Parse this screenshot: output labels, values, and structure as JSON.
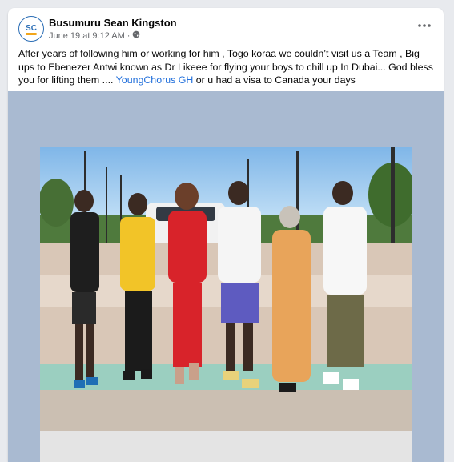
{
  "post": {
    "author": "Busumuru Sean Kingston",
    "avatar_initials": "SC",
    "date": "June 19 at 9:12 AM",
    "separator": "·",
    "audience_icon": "globe-icon",
    "more_icon": "more-options-icon",
    "text_part1": "After years of following him or working for him , Togo koraa we couldn’t visit us a Team , Big ups to Ebenezer Antwi known as Dr Likeee for flying your boys to chill up In Dubai... God bless you for lifting them .... ",
    "mention": "YoungChorus GH",
    "text_part2": " or u had a visa to Canada your days"
  },
  "colors": {
    "mention": "#216fdb",
    "media_background": "#a9bad1",
    "avatar_border": "#2a6db5",
    "avatar_accent": "#f2a51a"
  }
}
